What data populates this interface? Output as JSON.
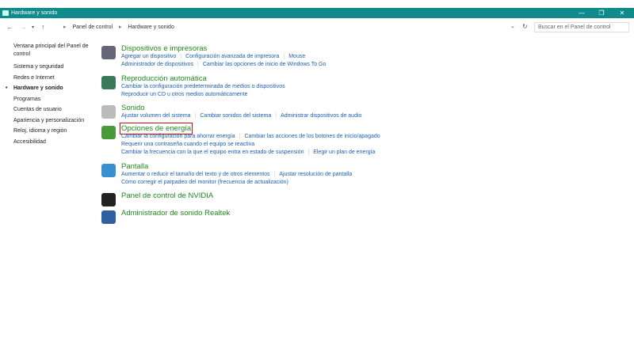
{
  "window": {
    "title": "Hardware y sonido",
    "controls": [
      "—",
      "❐",
      "✕"
    ]
  },
  "address": {
    "breadcrumb": [
      "Panel de control",
      "Hardware y sonido"
    ],
    "search_placeholder": "Buscar en el Panel de control"
  },
  "sidebar": {
    "items": [
      {
        "label": "Ventana principal del Panel de control"
      },
      {
        "label": "Sistema y seguridad"
      },
      {
        "label": "Redes e Internet"
      },
      {
        "label": "Hardware y sonido",
        "active": true
      },
      {
        "label": "Programas"
      },
      {
        "label": "Cuentas de usuario"
      },
      {
        "label": "Apariencia y personalización"
      },
      {
        "label": "Reloj, idioma y región"
      },
      {
        "label": "Accesibilidad"
      }
    ]
  },
  "sections": [
    {
      "title": "Dispositivos e impresoras",
      "icon": "printer-icon",
      "lines": [
        [
          "Agregar un dispositivo",
          "Configuración avanzada de impresora",
          "Mouse"
        ],
        [
          "Administrador de dispositivos",
          "Cambiar las opciones de inicio de Windows To Go"
        ]
      ]
    },
    {
      "title": "Reproducción automática",
      "icon": "autoplay-icon",
      "lines": [
        [
          "Cambiar la configuración predeterminada de medios o dispositivos"
        ],
        [
          "Reproducir un CD u otros medios automáticamente"
        ]
      ]
    },
    {
      "title": "Sonido",
      "icon": "speaker-icon",
      "lines": [
        [
          "Ajustar volumen del sistema",
          "Cambiar sonidos del sistema",
          "Administrar dispositivos de audio"
        ]
      ]
    },
    {
      "title": "Opciones de energía",
      "icon": "power-icon",
      "highlighted": true,
      "lines": [
        [
          "Cambiar la configuración para ahorrar energía",
          "Cambiar las acciones de los botones de inicio/apagado"
        ],
        [
          "Requerir una contraseña cuando el equipo se reactiva"
        ],
        [
          "Cambiar la frecuencia con la que el equipo entra en estado de suspensión",
          "Elegir un plan de energía"
        ]
      ]
    },
    {
      "title": "Pantalla",
      "icon": "display-icon",
      "lines": [
        [
          "Aumentar o reducir el tamaño del texto y de otros elementos",
          "Ajustar resolución de pantalla"
        ],
        [
          "Cómo corregir el parpadeo del monitor (frecuencia de actualización)"
        ]
      ]
    },
    {
      "title": "Panel de control de NVIDIA",
      "icon": "nvidia-icon",
      "lines": []
    },
    {
      "title": "Administrador de sonido Realtek",
      "icon": "realtek-icon",
      "lines": []
    }
  ],
  "colors": {
    "titlebar": "#0f8b8b",
    "heading": "#1e8a1e",
    "link": "#1a5fb4",
    "highlight": "#d01010"
  }
}
